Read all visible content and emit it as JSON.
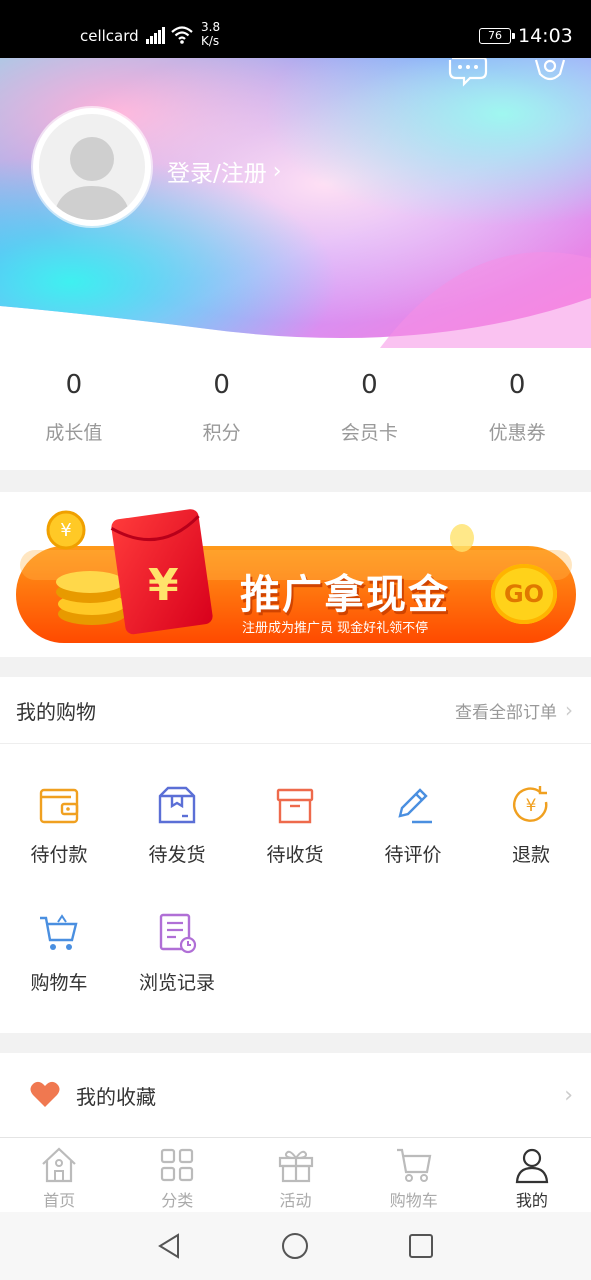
{
  "status_bar": {
    "carrier": "cellcard",
    "speed_value": "3.8",
    "speed_unit": "K/s",
    "battery": "76",
    "time": "14:03"
  },
  "header": {
    "login_label": "登录/注册",
    "icons": [
      "message-icon",
      "settings-icon"
    ]
  },
  "stats": [
    {
      "value": "0",
      "label": "成长值"
    },
    {
      "value": "0",
      "label": "积分"
    },
    {
      "value": "0",
      "label": "会员卡"
    },
    {
      "value": "0",
      "label": "优惠券"
    }
  ],
  "banner": {
    "title": "推广拿现金",
    "subtitle": "注册成为推广员  现金好礼领不停",
    "go": "GO",
    "yen": "¥"
  },
  "shopping": {
    "title": "我的购物",
    "view_all": "查看全部订单",
    "items": [
      {
        "label": "待付款",
        "icon": "wallet-icon",
        "color": "#f0a020"
      },
      {
        "label": "待发货",
        "icon": "package-icon",
        "color": "#5b6fd6"
      },
      {
        "label": "待收货",
        "icon": "box-icon",
        "color": "#ee6a4c"
      },
      {
        "label": "待评价",
        "icon": "pencil-icon",
        "color": "#4a8fe0"
      },
      {
        "label": "退款",
        "icon": "refund-icon",
        "color": "#f0a020"
      },
      {
        "label": "购物车",
        "icon": "cart-icon",
        "color": "#4a8fe0"
      },
      {
        "label": "浏览记录",
        "icon": "history-icon",
        "color": "#b06fd6"
      }
    ]
  },
  "favorites": {
    "label": "我的收藏",
    "icon_color": "#f07850"
  },
  "tabbar": {
    "tabs": [
      {
        "label": "首页",
        "icon": "home-icon"
      },
      {
        "label": "分类",
        "icon": "grid-icon"
      },
      {
        "label": "活动",
        "icon": "gift-icon"
      },
      {
        "label": "购物车",
        "icon": "cart-icon"
      },
      {
        "label": "我的",
        "icon": "user-icon",
        "active": true
      }
    ]
  }
}
